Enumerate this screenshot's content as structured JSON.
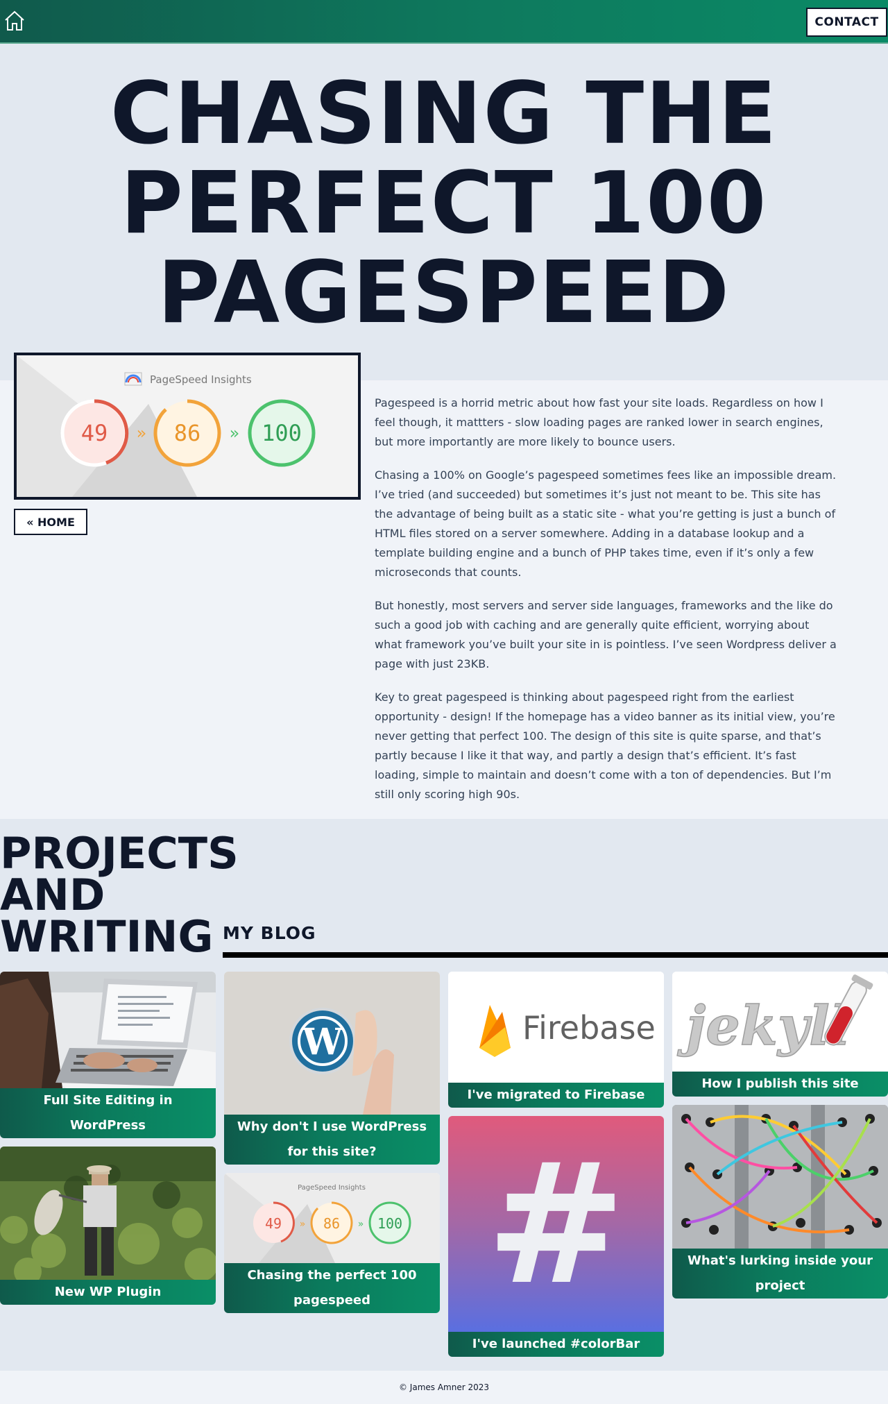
{
  "nav": {
    "contact_label": "CONTACT"
  },
  "hero": {
    "title_lines": [
      "CHASING THE",
      "PERFECT 100",
      "PAGESPEED"
    ]
  },
  "feature_image": {
    "heading": "PageSpeed Insights",
    "scores": [
      "49",
      "86",
      "100"
    ],
    "arrow": "»"
  },
  "home_button": "« HOME",
  "article": {
    "paragraphs": [
      "Pagespeed is a horrid metric about how fast your site loads. Regardless on how I feel though, it mattters - slow loading pages are ranked lower in search engines, but more importantly are more likely to bounce users.",
      "Chasing a 100% on Google’s pagespeed sometimes fees like an impossible dream. I’ve tried (and succeeded) but sometimes it’s just not meant to be. This site has the advantage of being built as a static site - what you’re getting is just a bunch of HTML files stored on a server somewhere. Adding in a database lookup and a template building engine and a bunch of PHP takes time, even if it’s only a few microseconds that counts.",
      "But honestly, most servers and server side languages, frameworks and the like do such a good job with caching and are generally quite efficient, worrying about what framework you’ve built your site in is pointless. I’ve seen Wordpress deliver a page with just 23KB.",
      "Key to great pagespeed is thinking about pagespeed right from the earliest opportunity - design! If the homepage has a video banner as its initial view, you’re never getting that perfect 100. The design of this site is quite sparse, and that’s partly because I like it that way, and partly a design that’s efficient. It’s fast loading, simple to maintain and doesn’t come with a ton of dependencies. But I’m still only scoring high 90s."
    ]
  },
  "projects": {
    "title_lines": [
      "PROJECTS",
      "AND",
      "WRITING"
    ],
    "blog_heading": "MY BLOG",
    "cards": [
      {
        "label": "Full Site Editing in WordPress",
        "image": "laptop-photo"
      },
      {
        "label": "New WP Plugin",
        "image": "field-photo"
      },
      {
        "label": "Why don't I use WordPress for this site?",
        "image": "wordpress-logo-photo"
      },
      {
        "label": "Chasing the perfect 100 pagespeed",
        "image": "pagespeed-insights"
      },
      {
        "label": "I've migrated to Firebase",
        "image": "firebase-logo",
        "logo_text": "Firebase"
      },
      {
        "label": "I've launched #colorBar",
        "image": "hash-gradient",
        "glyph": "#"
      },
      {
        "label": "How I publish this site",
        "image": "jekyll-logo",
        "logo_text": "jekyll"
      },
      {
        "label": "What's lurking inside your project",
        "image": "cables-photo"
      }
    ]
  },
  "footer": {
    "text": "© James Amner 2023"
  },
  "colors": {
    "accent": "#0a8f67",
    "dark": "#0f172a",
    "score_red": "#e05a47",
    "score_orange": "#f2a33a",
    "score_green": "#4cc26d"
  }
}
